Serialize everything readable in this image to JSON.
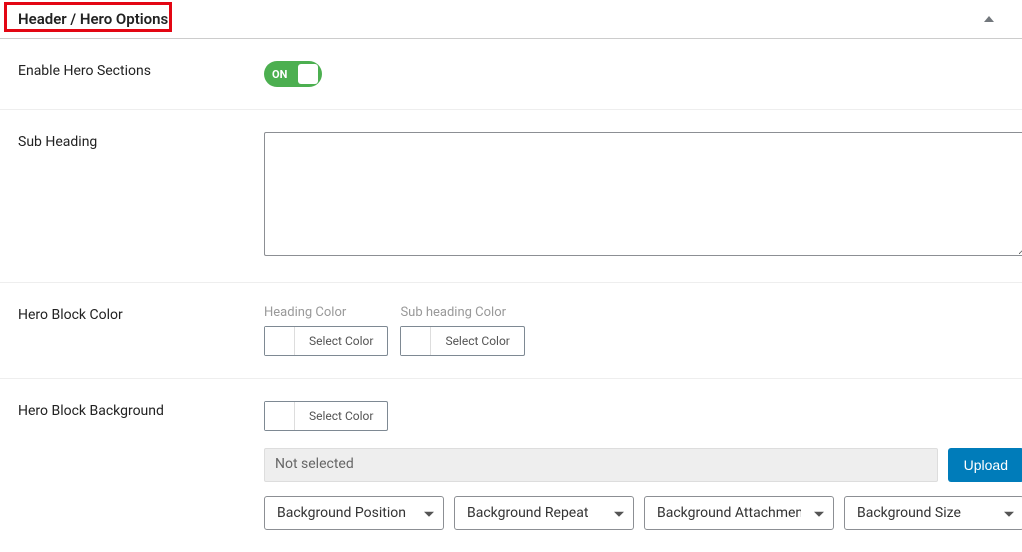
{
  "header": {
    "title": "Header / Hero Options"
  },
  "fields": {
    "enable_hero": {
      "label": "Enable Hero Sections",
      "toggle_state": "ON"
    },
    "sub_heading": {
      "label": "Sub Heading",
      "value": ""
    },
    "hero_color": {
      "label": "Hero Block Color",
      "heading_color_label": "Heading Color",
      "sub_heading_color_label": "Sub heading Color",
      "select_color": "Select Color"
    },
    "hero_bg": {
      "label": "Hero Block Background",
      "select_color": "Select Color",
      "file_placeholder": "Not selected",
      "upload": "Upload",
      "bg_position": "Background Position",
      "bg_repeat": "Background Repeat",
      "bg_attachment": "Background Attachment",
      "bg_size": "Background Size"
    }
  }
}
